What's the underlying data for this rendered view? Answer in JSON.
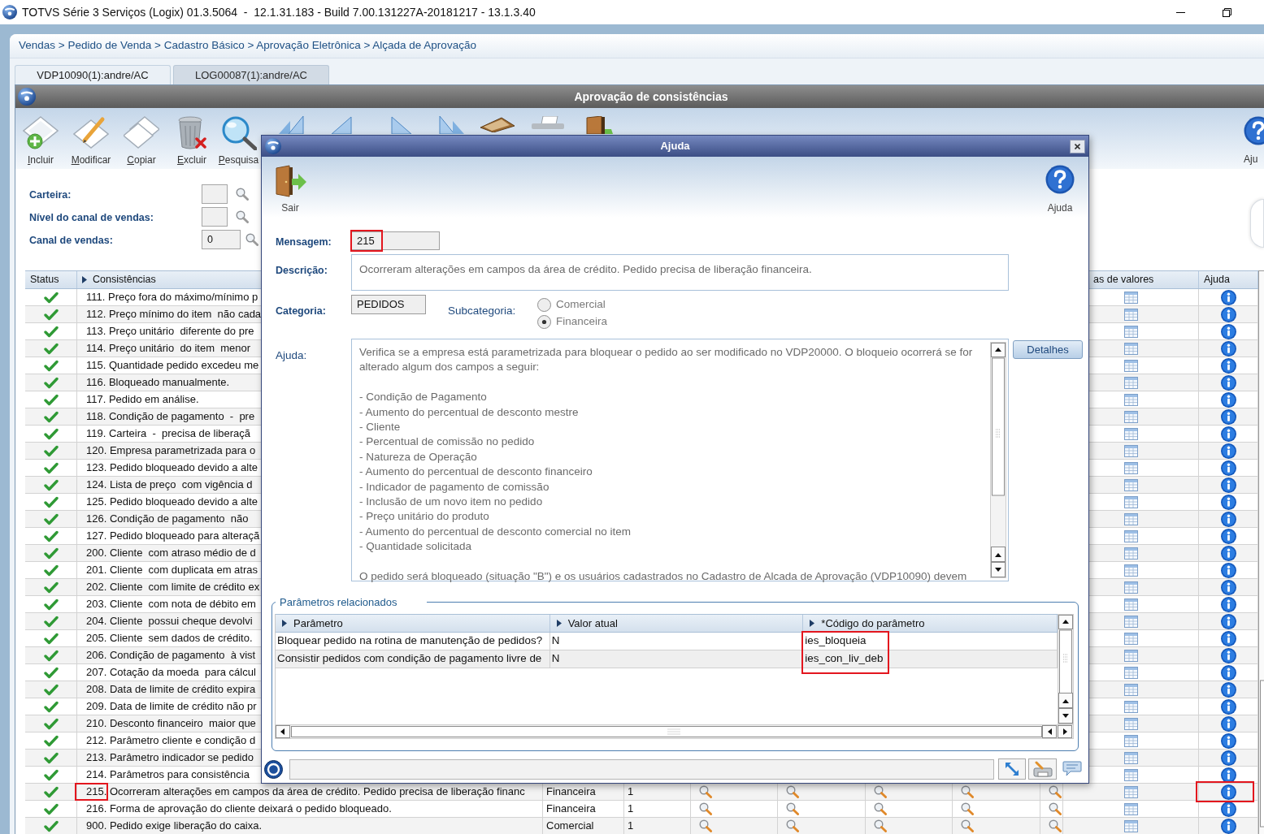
{
  "window": {
    "title": "TOTVS Série 3 Serviços (Logix) 01.3.5064  -  12.1.31.183 - Build 7.00.131227A-20181217 - 13.1.3.40"
  },
  "breadcrumb": "Vendas > Pedido de Venda > Cadastro Básico > Aprovação Eletrônica > Alçada de Aprovação",
  "tabs": [
    {
      "label": "VDP10090(1):andre/AC",
      "selected": true
    },
    {
      "label": "LOG00087(1):andre/AC",
      "selected": false
    }
  ],
  "program": {
    "title": "Aprovação de consistências",
    "toolbar": [
      {
        "kind": "add",
        "label": "Incluir"
      },
      {
        "kind": "edit",
        "label": "Modificar"
      },
      {
        "kind": "copy",
        "label": "Copiar"
      },
      {
        "kind": "delete",
        "label": "Excluir"
      },
      {
        "kind": "search",
        "label": "Pesquisa"
      },
      {
        "kind": "first"
      },
      {
        "kind": "previous"
      },
      {
        "kind": "next"
      },
      {
        "kind": "last"
      },
      {
        "kind": "book"
      },
      {
        "kind": "printer"
      },
      {
        "kind": "exit"
      }
    ],
    "help_button": {
      "label": "Aju"
    },
    "filters": [
      {
        "label": "Carteira:"
      },
      {
        "label": "Nível do canal de vendas:"
      },
      {
        "label": "Canal de vendas:",
        "value": "0"
      }
    ],
    "table": {
      "columns": [
        {
          "label": "Status",
          "arrow": false
        },
        {
          "label": "Consistências",
          "arrow": true
        },
        {
          "label": "as de valores",
          "arrow": false
        },
        {
          "label": "Ajuda",
          "arrow": false
        }
      ],
      "rows": [
        {
          "approved": true,
          "text": "111. Preço fora do máximo/mínimo p",
          "highlighted": false
        },
        {
          "approved": true,
          "text": "112. Preço mínimo do item  não cada",
          "highlighted": false
        },
        {
          "approved": true,
          "text": "113. Preço unitário  diferente do pre",
          "highlighted": false
        },
        {
          "approved": true,
          "text": "114. Preço unitário  do item  menor",
          "highlighted": false
        },
        {
          "approved": true,
          "text": "115. Quantidade pedido excedeu me",
          "highlighted": false
        },
        {
          "approved": true,
          "text": "116. Bloqueado manualmente.",
          "highlighted": false
        },
        {
          "approved": true,
          "text": "117. Pedido em análise.",
          "highlighted": false
        },
        {
          "approved": true,
          "text": "118. Condição de pagamento  -  pre",
          "highlighted": false
        },
        {
          "approved": true,
          "text": "119. Carteira  -  precisa de liberaçã",
          "highlighted": false
        },
        {
          "approved": true,
          "text": "120. Empresa parametrizada para o",
          "highlighted": false
        },
        {
          "approved": true,
          "text": "123. Pedido bloqueado devido a alte",
          "highlighted": false
        },
        {
          "approved": true,
          "text": "124. Lista de preço  com vigência d",
          "highlighted": false
        },
        {
          "approved": true,
          "text": "125. Pedido bloqueado devido a alte",
          "highlighted": false
        },
        {
          "approved": true,
          "text": "126. Condição de pagamento  não",
          "highlighted": false
        },
        {
          "approved": true,
          "text": "127. Pedido bloqueado para alteraçã",
          "highlighted": false
        },
        {
          "approved": true,
          "text": "200. Cliente  com atraso médio de d",
          "highlighted": false
        },
        {
          "approved": true,
          "text": "201. Cliente  com duplicata em atras",
          "highlighted": false
        },
        {
          "approved": true,
          "text": "202. Cliente  com limite de crédito ex",
          "highlighted": false
        },
        {
          "approved": true,
          "text": "203. Cliente  com nota de débito em",
          "highlighted": false
        },
        {
          "approved": true,
          "text": "204. Cliente  possui cheque devolvi",
          "highlighted": false
        },
        {
          "approved": true,
          "text": "205. Cliente  sem dados de crédito.",
          "highlighted": false
        },
        {
          "approved": true,
          "text": "206. Condição de pagamento  à vist",
          "highlighted": false
        },
        {
          "approved": true,
          "text": "207. Cotação da moeda  para cálcul",
          "highlighted": false
        },
        {
          "approved": true,
          "text": "208. Data de limite de crédito expira",
          "highlighted": false
        },
        {
          "approved": true,
          "text": "209. Data de limite de crédito não pr",
          "highlighted": false
        },
        {
          "approved": true,
          "text": "210. Desconto financeiro  maior que",
          "highlighted": false
        },
        {
          "approved": true,
          "text": "212. Parâmetro cliente e condição d",
          "highlighted": false
        },
        {
          "approved": true,
          "text": "213. Parâmetro indicador se pedido",
          "highlighted": false
        },
        {
          "approved": true,
          "text": "214. Parâmetros para consistência",
          "highlighted": false
        },
        {
          "approved": true,
          "text": "215. Ocorreram alterações em campos da área de crédito. Pedido precisa de liberação financ",
          "column_3": "Financeira",
          "column_4": "1",
          "highlighted": true
        },
        {
          "approved": true,
          "text": "216. Forma de aprovação do cliente deixará o pedido bloqueado.",
          "column_3": "Financeira",
          "column_4": "1",
          "highlighted": false
        },
        {
          "approved": true,
          "text": "900. Pedido exige liberação do caixa.",
          "column_3": "Comercial",
          "column_4": "1",
          "highlighted": false
        }
      ]
    }
  },
  "dialog": {
    "title": "Ajuda",
    "toolbar": [
      {
        "kind": "exit",
        "label": "Sair"
      },
      {
        "kind": "help",
        "label": "Ajuda"
      }
    ],
    "message": {
      "label": "Mensagem:",
      "value": "215",
      "highlighted": true
    },
    "description": {
      "label": "Descrição:",
      "value": "Ocorreram alterações em campos da área de crédito. Pedido precisa de liberação financeira."
    },
    "category": {
      "label": "Categoria:",
      "value": "PEDIDOS"
    },
    "subcategory": {
      "label": "Subcategoria:",
      "options": [
        {
          "label": "Comercial",
          "selected": false
        },
        {
          "label": "Financeira",
          "selected": true
        }
      ]
    },
    "help": {
      "label": "Ajuda:",
      "intro": "Verifica se a empresa está parametrizada para bloquear o pedido ao ser modificado no VDP20000. O bloqueio ocorrerá se for alterado algum dos campos a seguir:",
      "items": [
        "- Condição de Pagamento",
        "- Aumento do percentual de desconto mestre",
        "- Cliente",
        "- Percentual de comissão no pedido",
        "- Natureza de Operação",
        "- Aumento do percentual de desconto financeiro",
        "- Indicador de pagamento de comissão",
        "- Inclusão de um novo item no pedido",
        "- Preço unitário do produto",
        "- Aumento do percentual de desconto comercial no item",
        "- Quantidade solicitada"
      ],
      "closing": "O pedido será bloqueado (situação \"B\") e os usuários cadastrados no Cadastro de Alcada de Aprovação (VDP10090) devem",
      "button": "Detalhes"
    },
    "parameters": {
      "title": "Parâmetros relacionados",
      "columns": [
        "Parâmetro",
        "Valor atual",
        "*Código do parâmetro"
      ],
      "rows": [
        {
          "cells": [
            "Bloquear pedido na rotina de manutenção de pedidos?",
            "N",
            "ies_bloqueia"
          ],
          "highlighted": true
        },
        {
          "cells": [
            "Consistir pedidos com condição de pagamento livre de",
            "N",
            "ies_con_liv_deb"
          ],
          "highlighted": true
        }
      ]
    }
  }
}
